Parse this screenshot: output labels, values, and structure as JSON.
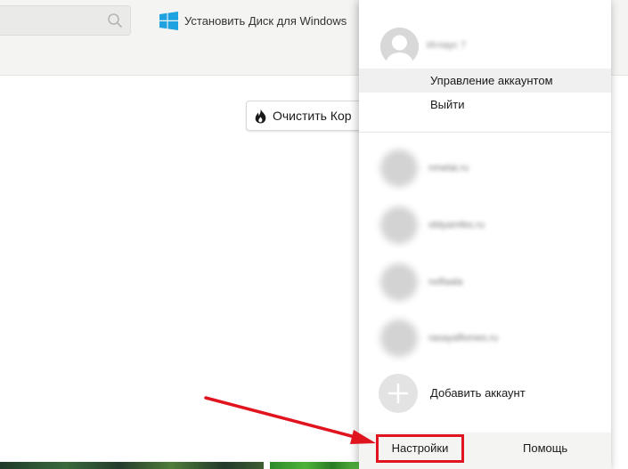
{
  "header": {
    "install_label": "Установить Диск для Windows"
  },
  "main": {
    "clear_trash_label": "Очистить Кор"
  },
  "account_menu": {
    "current_user_name": "Иглаус 7",
    "manage_label": "Управление аккаунтом",
    "logout_label": "Выйти",
    "other_accounts": [
      {
        "email": "nmelai.ru"
      },
      {
        "email": "oblyamfes.ru"
      },
      {
        "email": "noflaala"
      },
      {
        "email": "rasayaflomes.ru"
      }
    ],
    "add_account_label": "Добавить аккаунт",
    "settings_label": "Настройки",
    "help_label": "Помощь"
  },
  "colors": {
    "annotation_red": "#e0141e",
    "windows_blue": "#1fa3e0",
    "header_bg": "#f4f4f2",
    "highlight_bg": "#f0f0f0"
  },
  "icons": [
    "search-icon",
    "windows-icon",
    "flame-icon",
    "avatar-icon",
    "plus-icon",
    "arrow-annotation"
  ]
}
